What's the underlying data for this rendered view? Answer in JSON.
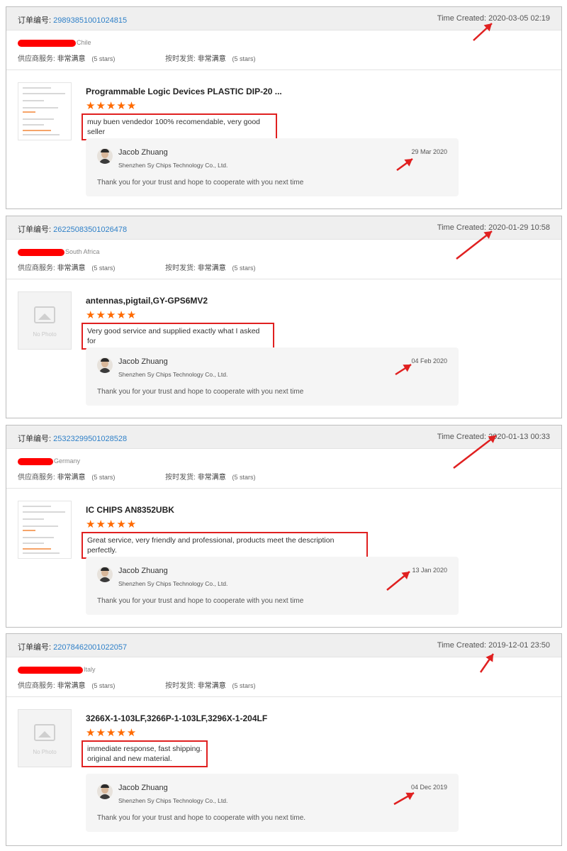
{
  "labels": {
    "order_label": "订单编号:",
    "time_created_label": "Time Created:",
    "supplier_service_label": "供应商服务:",
    "shipping_label": "按时发货:",
    "rating_value": "非常满意",
    "rating_stars": "(5 stars)",
    "no_photo": "No Photo"
  },
  "colors": {
    "link": "#2f80c8",
    "star": "#ff6a00",
    "highlight": "#e02020"
  },
  "reviews": [
    {
      "order_number": "29893851001024815",
      "time_created": "2020-03-05 02:19",
      "country": "Chile",
      "product_title": "Programmable Logic Devices PLASTIC DIP-20 ...",
      "image": "document-thumbnail",
      "star_rating": 5,
      "comment_lines": [
        "muy buen vendedor 100% recomendable, very good seller"
      ],
      "reply": {
        "seller_name": "Jacob Zhuang",
        "company": "Shenzhen Sy Chips Technology Co., Ltd.",
        "date": "29 Mar 2020",
        "text": "Thank you for your trust and hope to cooperate with you next time"
      }
    },
    {
      "order_number": "26225083501026478",
      "time_created": "2020-01-29 10:58",
      "country": "South Africa",
      "product_title": "antennas,pigtail,GY-GPS6MV2",
      "image": "no-photo",
      "star_rating": 5,
      "comment_lines": [
        "Very good service and supplied exactly what I asked for"
      ],
      "reply": {
        "seller_name": "Jacob Zhuang",
        "company": "Shenzhen Sy Chips Technology Co., Ltd.",
        "date": "04 Feb 2020",
        "text": "Thank you for your trust and hope to cooperate with you next time"
      }
    },
    {
      "order_number": "25323299501028528",
      "time_created": "2020-01-13 00:33",
      "country": "Germany",
      "product_title": "IC CHIPS AN8352UBK",
      "image": "document-thumbnail",
      "star_rating": 5,
      "comment_lines": [
        "Great service, very friendly and professional, products meet the description perfectly."
      ],
      "reply": {
        "seller_name": "Jacob Zhuang",
        "company": "Shenzhen Sy Chips Technology Co., Ltd.",
        "date": "13 Jan 2020",
        "text": "Thank you for your trust and hope to cooperate with you next time"
      }
    },
    {
      "order_number": "22078462001022057",
      "time_created": "2019-12-01 23:50",
      "country": "Italy",
      "product_title": "3266X-1-103LF,3266P-1-103LF,3296X-1-204LF",
      "image": "no-photo",
      "star_rating": 5,
      "comment_lines": [
        "immediate response, fast shipping.",
        "original and new material."
      ],
      "reply": {
        "seller_name": "Jacob Zhuang",
        "company": "Shenzhen Sy Chips Technology Co., Ltd.",
        "date": "04 Dec 2019",
        "text": "Thank you for your trust and hope to cooperate with you next time."
      }
    }
  ]
}
